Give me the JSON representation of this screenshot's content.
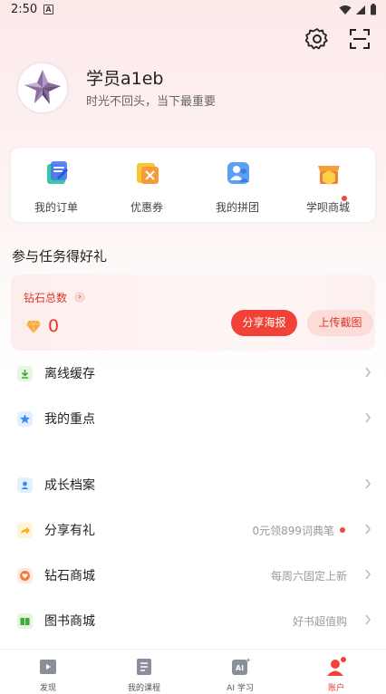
{
  "status_bar": {
    "time": "2:50",
    "notification_letter": "A"
  },
  "header": {
    "settings_icon": "gear-icon",
    "scan_icon": "scan-icon"
  },
  "profile": {
    "name": "学员a1eb",
    "motto": "时光不回头，当下最重要"
  },
  "quick_actions": [
    {
      "label": "我的订单",
      "icon": "order-icon",
      "has_dot": false
    },
    {
      "label": "优惠券",
      "icon": "coupon-icon",
      "has_dot": false
    },
    {
      "label": "我的拼团",
      "icon": "group-buy-icon",
      "has_dot": false
    },
    {
      "label": "学呗商城",
      "icon": "shop-icon",
      "has_dot": true
    }
  ],
  "tasks": {
    "section_title": "参与任务得好礼",
    "diamond_title": "钻石总数",
    "diamond_count": "0",
    "share_poster_label": "分享海报",
    "upload_screenshot_label": "上传截图"
  },
  "list_group1": [
    {
      "label": "离线缓存",
      "icon": "download-icon",
      "right_text": ""
    },
    {
      "label": "我的重点",
      "icon": "star-icon",
      "right_text": ""
    }
  ],
  "list_group2": [
    {
      "label": "成长档案",
      "icon": "profile-card-icon",
      "right_text": ""
    },
    {
      "label": "分享有礼",
      "icon": "share-icon",
      "right_text": "0元领899词典笔",
      "has_dot": true
    },
    {
      "label": "钻石商城",
      "icon": "heart-icon",
      "right_text": "每周六固定上新"
    },
    {
      "label": "图书商城",
      "icon": "book-icon",
      "right_text": "好书超值购"
    }
  ],
  "bottom_nav": [
    {
      "label": "发现",
      "icon": "discover-icon",
      "active": false
    },
    {
      "label": "我的课程",
      "icon": "courses-icon",
      "active": false
    },
    {
      "label": "AI 学习",
      "icon": "ai-learning-icon",
      "active": false
    },
    {
      "label": "账户",
      "icon": "account-icon",
      "active": true
    }
  ],
  "colors": {
    "accent_red": "#f04236",
    "accent_light": "#fbdcd9",
    "text_gray": "#9a9a9a"
  }
}
